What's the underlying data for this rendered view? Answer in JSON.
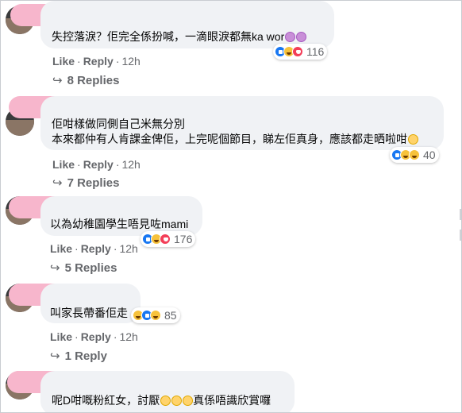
{
  "comments": [
    {
      "text_lines": [
        "失控落淚？佢完全係扮喊，一滴眼淚都無ka wor"
      ],
      "trailing_emoji": [
        "sad-face-emoji",
        "sad-face-emoji"
      ],
      "reactions": [
        "like",
        "haha",
        "love"
      ],
      "reaction_count": "116",
      "like_label": "Like",
      "reply_label": "Reply",
      "time": "12h",
      "replies": "8 Replies"
    },
    {
      "text_lines": [
        "佢咁樣做同側自己米無分別",
        "本來都仲有人肯課金俾佢，上完呢個節目，睇左佢真身，應該都走晒啦咁"
      ],
      "trailing_emoji": [
        "eye-roll-emoji"
      ],
      "reactions": [
        "like",
        "haha",
        "care"
      ],
      "reaction_count": "40",
      "like_label": "Like",
      "reply_label": "Reply",
      "time": "12h",
      "replies": "7 Replies"
    },
    {
      "text_lines": [
        "以為幼稚園學生唔見咗mami"
      ],
      "trailing_emoji": [],
      "reactions": [
        "like",
        "haha",
        "love"
      ],
      "reaction_count": "176",
      "like_label": "Like",
      "reply_label": "Reply",
      "time": "12h",
      "replies": "5 Replies"
    },
    {
      "text_lines": [
        "叫家長帶番佢走"
      ],
      "trailing_emoji": [],
      "reactions": [
        "haha",
        "like",
        "wow"
      ],
      "reaction_count": "85",
      "like_label": "Like",
      "reply_label": "Reply",
      "time": "12h",
      "replies": "1 Reply"
    },
    {
      "text_lines": [
        "呢D咁嘅粉紅女，討厭",
        "真係唔識欣賞囉"
      ],
      "trailing_emoji": [
        "meh-face-emoji",
        "meh-face-emoji",
        "meh-face-emoji"
      ],
      "reactions": [],
      "reaction_count": "",
      "like_label": "",
      "reply_label": "",
      "time": "",
      "replies": ""
    }
  ],
  "colors": {
    "name_redaction": "#f7b6cc",
    "bubble": "#f0f2f5",
    "meta_text": "#65676b",
    "like_blue": "#1877f2",
    "love_red": "#f33e58",
    "haha_yellow": "#f7c23b"
  }
}
